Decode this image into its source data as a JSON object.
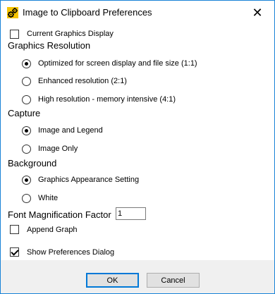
{
  "window": {
    "title": "Image to Clipboard Preferences",
    "close_glyph": "✕",
    "icon": "app-gear-icon"
  },
  "current_graphics_display": {
    "label": "Current Graphics Display",
    "checked": false
  },
  "graphics_resolution": {
    "heading": "Graphics Resolution",
    "options": [
      {
        "label": "Optimized for screen display and file size (1:1)",
        "selected": true
      },
      {
        "label": "Enhanced resolution (2:1)",
        "selected": false
      },
      {
        "label": "High resolution - memory intensive (4:1)",
        "selected": false
      }
    ]
  },
  "capture": {
    "heading": "Capture",
    "options": [
      {
        "label": "Image and Legend",
        "selected": true
      },
      {
        "label": "Image Only",
        "selected": false
      }
    ]
  },
  "background": {
    "heading": "Background",
    "options": [
      {
        "label": "Graphics Appearance Setting",
        "selected": true
      },
      {
        "label": "White",
        "selected": false
      }
    ]
  },
  "font_magnification": {
    "label": "Font Magnification Factor",
    "value": "1"
  },
  "append_graph": {
    "label": "Append Graph",
    "checked": false
  },
  "show_preferences_dialog": {
    "label": "Show Preferences Dialog",
    "checked": true
  },
  "buttons": {
    "ok": "OK",
    "cancel": "Cancel"
  },
  "colors": {
    "window_border": "#1883d7",
    "footer_bg": "#f0f0f0",
    "button_bg": "#e1e1e1",
    "default_button_border": "#0078d7",
    "icon_yellow": "#f5c400"
  }
}
